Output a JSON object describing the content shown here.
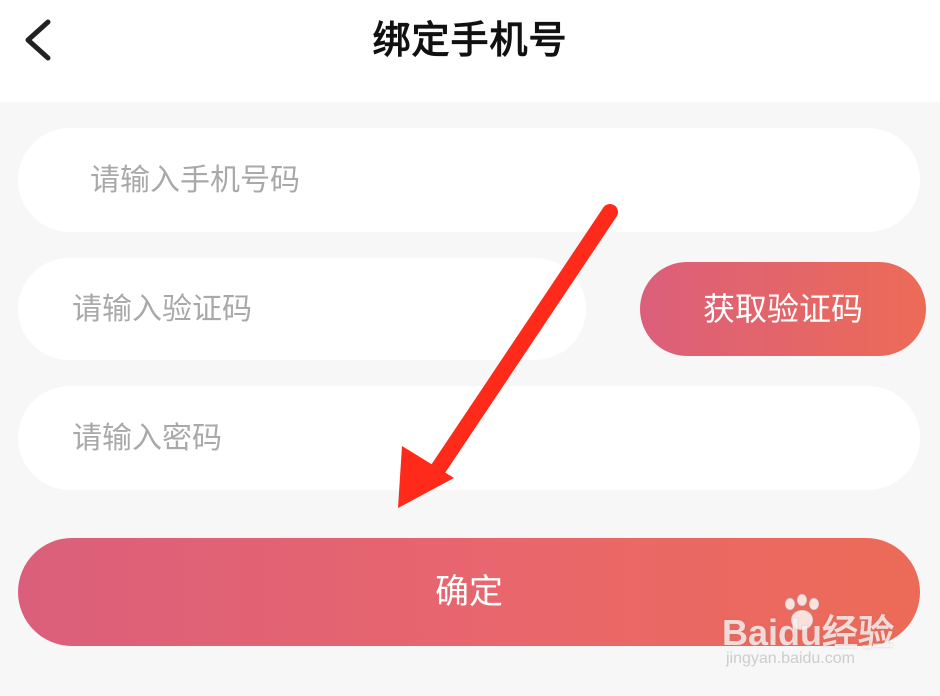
{
  "header": {
    "title": "绑定手机号",
    "back_icon": "chevron-left-icon"
  },
  "form": {
    "phone_placeholder": "请输入手机号码",
    "code_placeholder": "请输入验证码",
    "password_placeholder": "请输入密码",
    "get_code_label": "获取验证码",
    "confirm_label": "确定"
  },
  "watermark": {
    "logo": "Baidu经验",
    "url": "jingyan.baidu.com"
  },
  "colors": {
    "accent_start": "#db5f7b",
    "accent_end": "#ec6b57",
    "annotation_arrow": "#ff2a1a",
    "background": "#f7f7f7"
  }
}
